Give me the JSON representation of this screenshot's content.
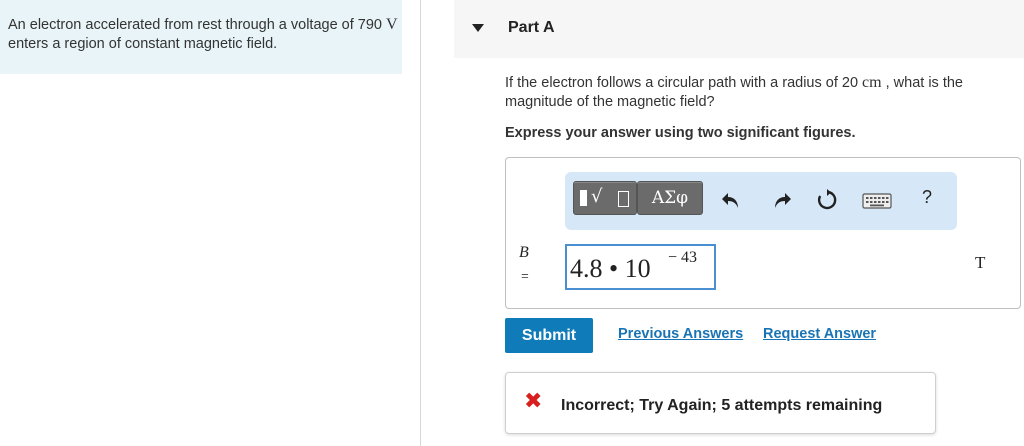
{
  "problem": {
    "text_before": "An electron accelerated from rest through a voltage of 790 ",
    "voltage_unit": "V",
    "text_after": " enters a region of constant magnetic field."
  },
  "part": {
    "title": "Part A",
    "question_before": "If the electron follows a circular path with a radius of 20 ",
    "radius_unit": "cm",
    "question_after": " , what is the magnitude of the magnetic field?",
    "instruction": "Express your answer using two significant figures."
  },
  "toolbar": {
    "greek_label": "ΑΣφ",
    "help_label": "?",
    "icons": [
      "templates-icon",
      "greek-symbols-icon",
      "undo-icon",
      "redo-icon",
      "reset-icon",
      "keyboard-icon",
      "help-icon"
    ]
  },
  "answer": {
    "variable": "B",
    "equals": "=",
    "mantissa": "4.8 • 10",
    "exponent": "− 43",
    "unit": "T"
  },
  "actions": {
    "submit_label": "Submit",
    "previous_answers_label": "Previous Answers",
    "request_answer_label": "Request Answer"
  },
  "feedback": {
    "icon": "x-icon",
    "text": "Incorrect; Try Again; 5 attempts remaining"
  },
  "colors": {
    "problem_bg": "#e8f4f8",
    "accent": "#0f7bb8",
    "link": "#1a74b3",
    "toolbar_bg": "#d6e8f7",
    "error": "#d81e1e",
    "input_border": "#4a8fd1"
  }
}
